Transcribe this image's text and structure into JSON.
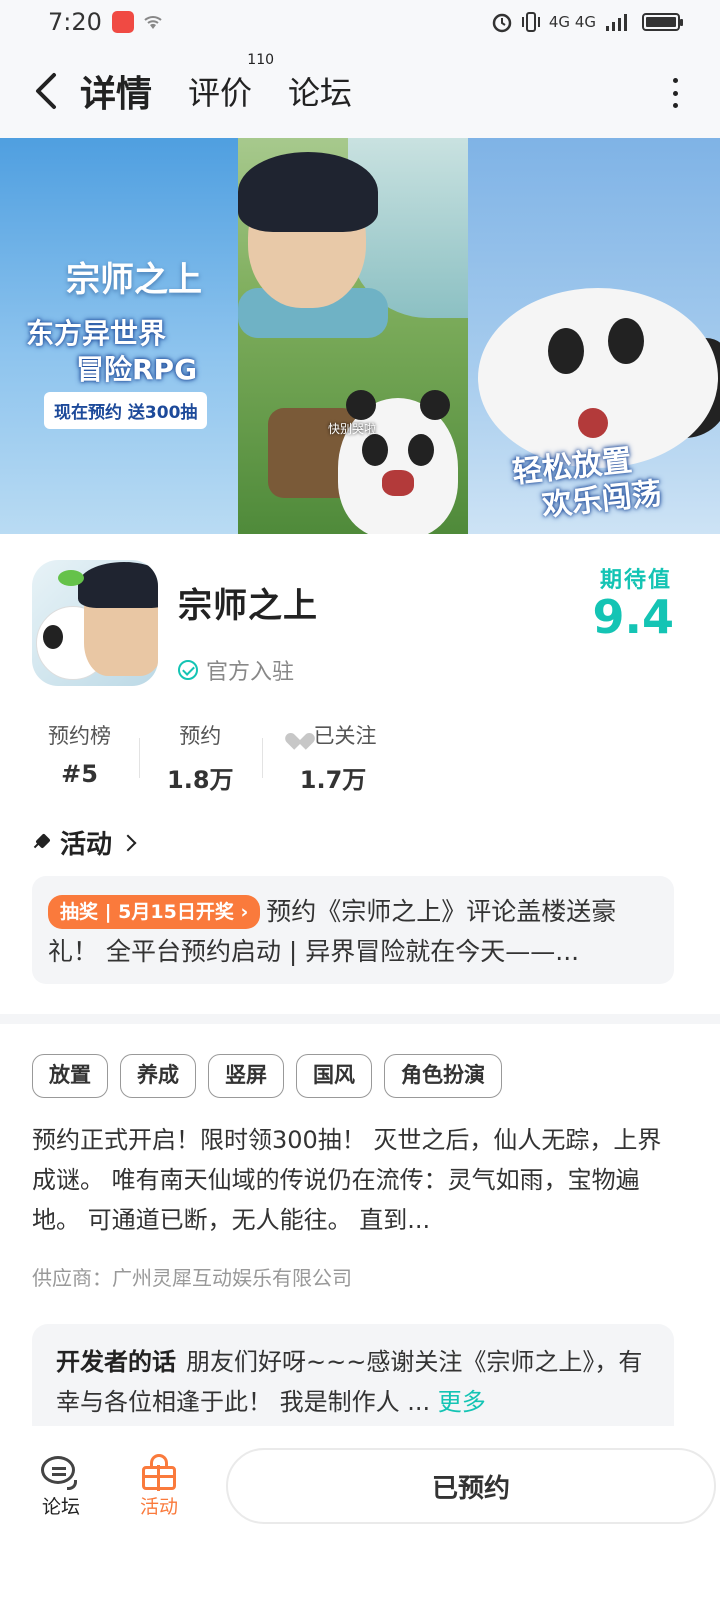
{
  "status_bar": {
    "time": "7:20",
    "signal_text": "4G 4G"
  },
  "header": {
    "tabs": [
      {
        "label": "详情",
        "active": true
      },
      {
        "label": "评价",
        "count": "110"
      },
      {
        "label": "论坛"
      }
    ]
  },
  "banner": {
    "panel1": {
      "logo": "宗师之上",
      "title_line1": "东方异世界",
      "title_line2": "冒险RPG",
      "badge": "现在预约 送300抽"
    },
    "panel2": {
      "caption": "快别哭啦"
    },
    "panel3": {
      "slogan_line1": "轻松放置",
      "slogan_line2": "欢乐闯荡"
    }
  },
  "game": {
    "title": "宗师之上",
    "official": "官方入驻",
    "expect_label": "期待值",
    "expect_value": "9.4",
    "stats": [
      {
        "label": "预约榜",
        "value": "#5"
      },
      {
        "label": "预约",
        "value": "1.8万"
      },
      {
        "label": "已关注",
        "value": "1.7万"
      }
    ]
  },
  "activity": {
    "heading": "活动",
    "tag": "抽奖 | 5月15日开奖 ›",
    "text": "预约《宗师之上》评论盖楼送豪礼！ 全平台预约启动 | 异界冒险就在今天——..."
  },
  "tags": [
    "放置",
    "养成",
    "竖屏",
    "国风",
    "角色扮演"
  ],
  "description": "预约正式开启！限时领300抽！ 灭世之后，仙人无踪，上界成谜。 唯有南天仙域的传说仍在流传：灵气如雨，宝物遍地。 可通道已断，无人能往。 直到...",
  "supplier": "供应商：广州灵犀互动娱乐有限公司",
  "developer": {
    "label": "开发者的话",
    "text": "朋友们好呀~~~感谢关注《宗师之上》，有幸与各位相逢于此！ 我是制作人 ...",
    "more": "更多"
  },
  "bottom_bar": {
    "forum_label": "论坛",
    "activity_label": "活动",
    "reserve_button": "已预约"
  },
  "colors": {
    "accent": "#14c4b4",
    "orange": "#fa7a3c"
  }
}
